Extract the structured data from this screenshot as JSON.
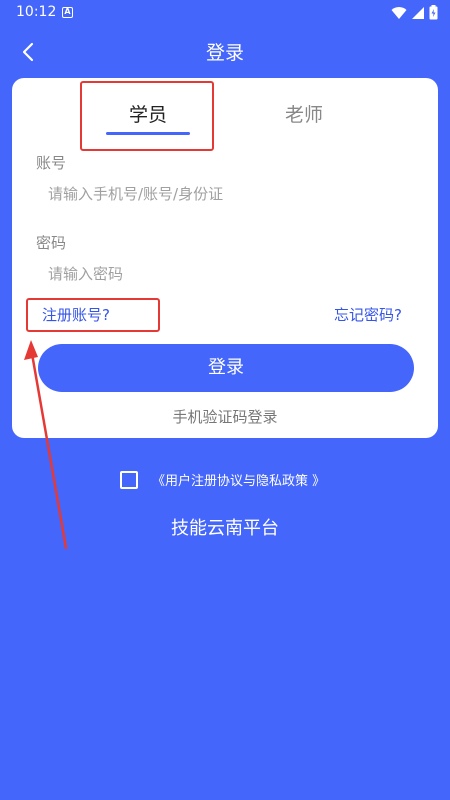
{
  "status_bar": {
    "time": "10:12",
    "notification_letter": "A"
  },
  "header": {
    "title": "登录"
  },
  "tabs": {
    "student": "学员",
    "teacher": "老师"
  },
  "account": {
    "label": "账号",
    "placeholder": "请输入手机号/账号/身份证"
  },
  "password": {
    "label": "密码",
    "placeholder": "请输入密码"
  },
  "links": {
    "register": "注册账号?",
    "forgot": "忘记密码?"
  },
  "login_button": "登录",
  "sms_login": "手机验证码登录",
  "agreement": {
    "text": "《用户注册协议与隐私政策 》",
    "checked": false
  },
  "platform_name": "技能云南平台",
  "colors": {
    "background": "#4466fb",
    "link": "#3555e8",
    "annotation": "#e53935"
  }
}
